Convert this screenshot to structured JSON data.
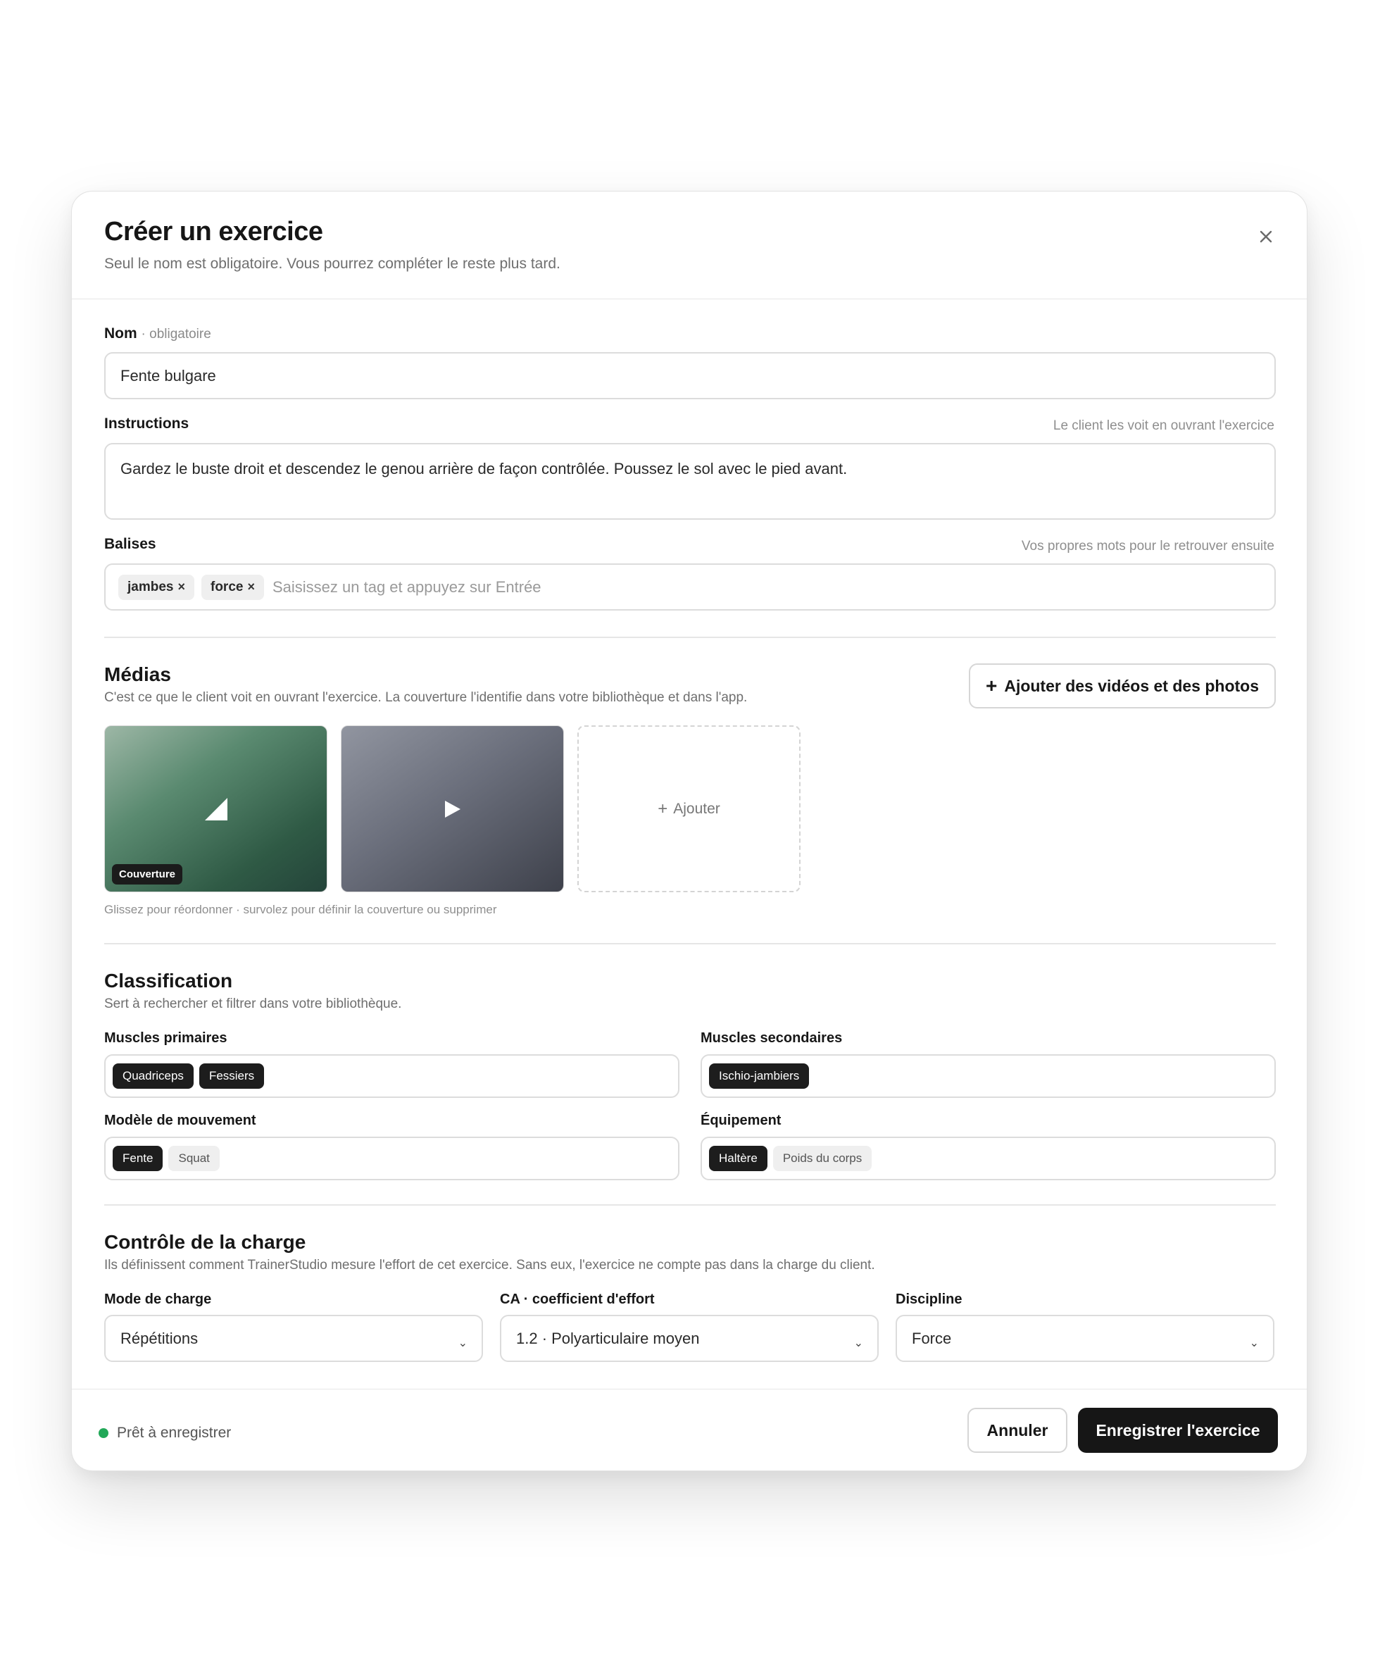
{
  "modal": {
    "title": "Créer un exercice",
    "subtitle": "Seul le nom est obligatoire. Vous pourrez compléter le reste plus tard."
  },
  "name_field": {
    "label": "Nom",
    "required_note": "· obligatoire",
    "value": "Fente bulgare"
  },
  "instructions_field": {
    "label": "Instructions",
    "hint": "Le client les voit en ouvrant l'exercice",
    "value": "Gardez le buste droit et descendez le genou arrière de façon contrôlée. Poussez le sol avec le pied avant."
  },
  "tags_field": {
    "label": "Balises",
    "hint": "Vos propres mots pour le retrouver ensuite",
    "tags": [
      "jambes",
      "force"
    ],
    "remove_glyph": "×",
    "placeholder": "Saisissez un tag et appuyez sur Entrée"
  },
  "media": {
    "title": "Médias",
    "description": "C'est ce que le client voit en ouvrant l'exercice. La couverture l'identifie dans votre bibliothèque et dans l'app.",
    "add_button": "Ajouter des vidéos et des photos",
    "cover_badge": "Couverture",
    "add_tile": "Ajouter",
    "hint": "Glissez pour réordonner · survolez pour définir la couverture ou supprimer"
  },
  "classification": {
    "title": "Classification",
    "description": "Sert à rechercher et filtrer dans votre bibliothèque.",
    "primary_muscles": {
      "label": "Muscles primaires",
      "chips": [
        "Quadriceps",
        "Fessiers"
      ]
    },
    "secondary_muscles": {
      "label": "Muscles secondaires",
      "chips": [
        "Ischio-jambiers"
      ]
    },
    "movement_pattern": {
      "label": "Modèle de mouvement",
      "selected": [
        "Fente"
      ],
      "unselected": [
        "Squat"
      ]
    },
    "equipment": {
      "label": "Équipement",
      "selected": [
        "Haltère"
      ],
      "unselected": [
        "Poids du corps"
      ]
    }
  },
  "load_control": {
    "title": "Contrôle de la charge",
    "description": "Ils définissent comment TrainerStudio mesure l'effort de cet exercice. Sans eux, l'exercice ne compte pas dans la charge du client.",
    "load_mode": {
      "label": "Mode de charge",
      "value": "Répétitions"
    },
    "effort_coefficient": {
      "label": "CA · coefficient d'effort",
      "value": "1.2 · Polyarticulaire moyen"
    },
    "discipline": {
      "label": "Discipline",
      "value": "Force"
    }
  },
  "footer": {
    "status": "Prêt à enregistrer",
    "status_color": "#22a858",
    "cancel": "Annuler",
    "save": "Enregistrer l'exercice"
  }
}
